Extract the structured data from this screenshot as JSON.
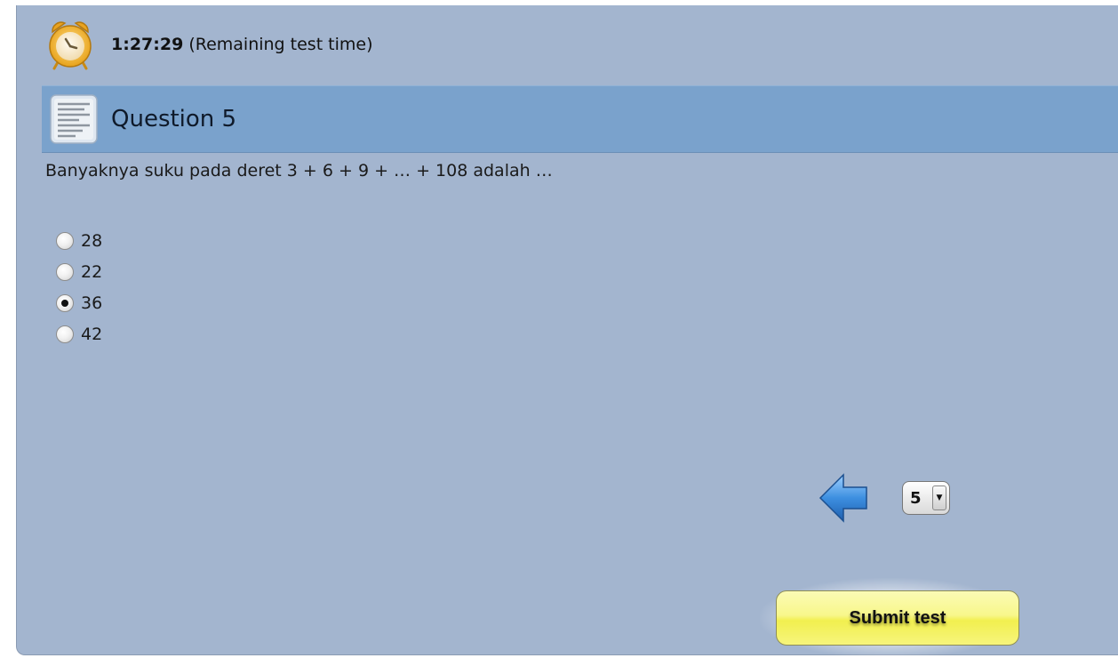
{
  "timer": {
    "value": "1:27:29",
    "label": "(Remaining test time)",
    "icon": "alarm-clock-icon"
  },
  "question": {
    "title": "Question 5",
    "icon": "document-icon",
    "text": "Banyaknya suku pada deret 3 + 6 + 9 + … + 108 adalah …"
  },
  "options": [
    {
      "label": "28",
      "selected": false
    },
    {
      "label": "22",
      "selected": false
    },
    {
      "label": "36",
      "selected": true
    },
    {
      "label": "42",
      "selected": false
    }
  ],
  "navigation": {
    "prev_icon": "left-arrow-icon",
    "page_selected": "5"
  },
  "submit": {
    "label": "Submit test"
  },
  "colors": {
    "panel_bg": "#a3b5cf",
    "header_bg": "#7aa2cc",
    "button_yellow": "#f8f78b"
  }
}
